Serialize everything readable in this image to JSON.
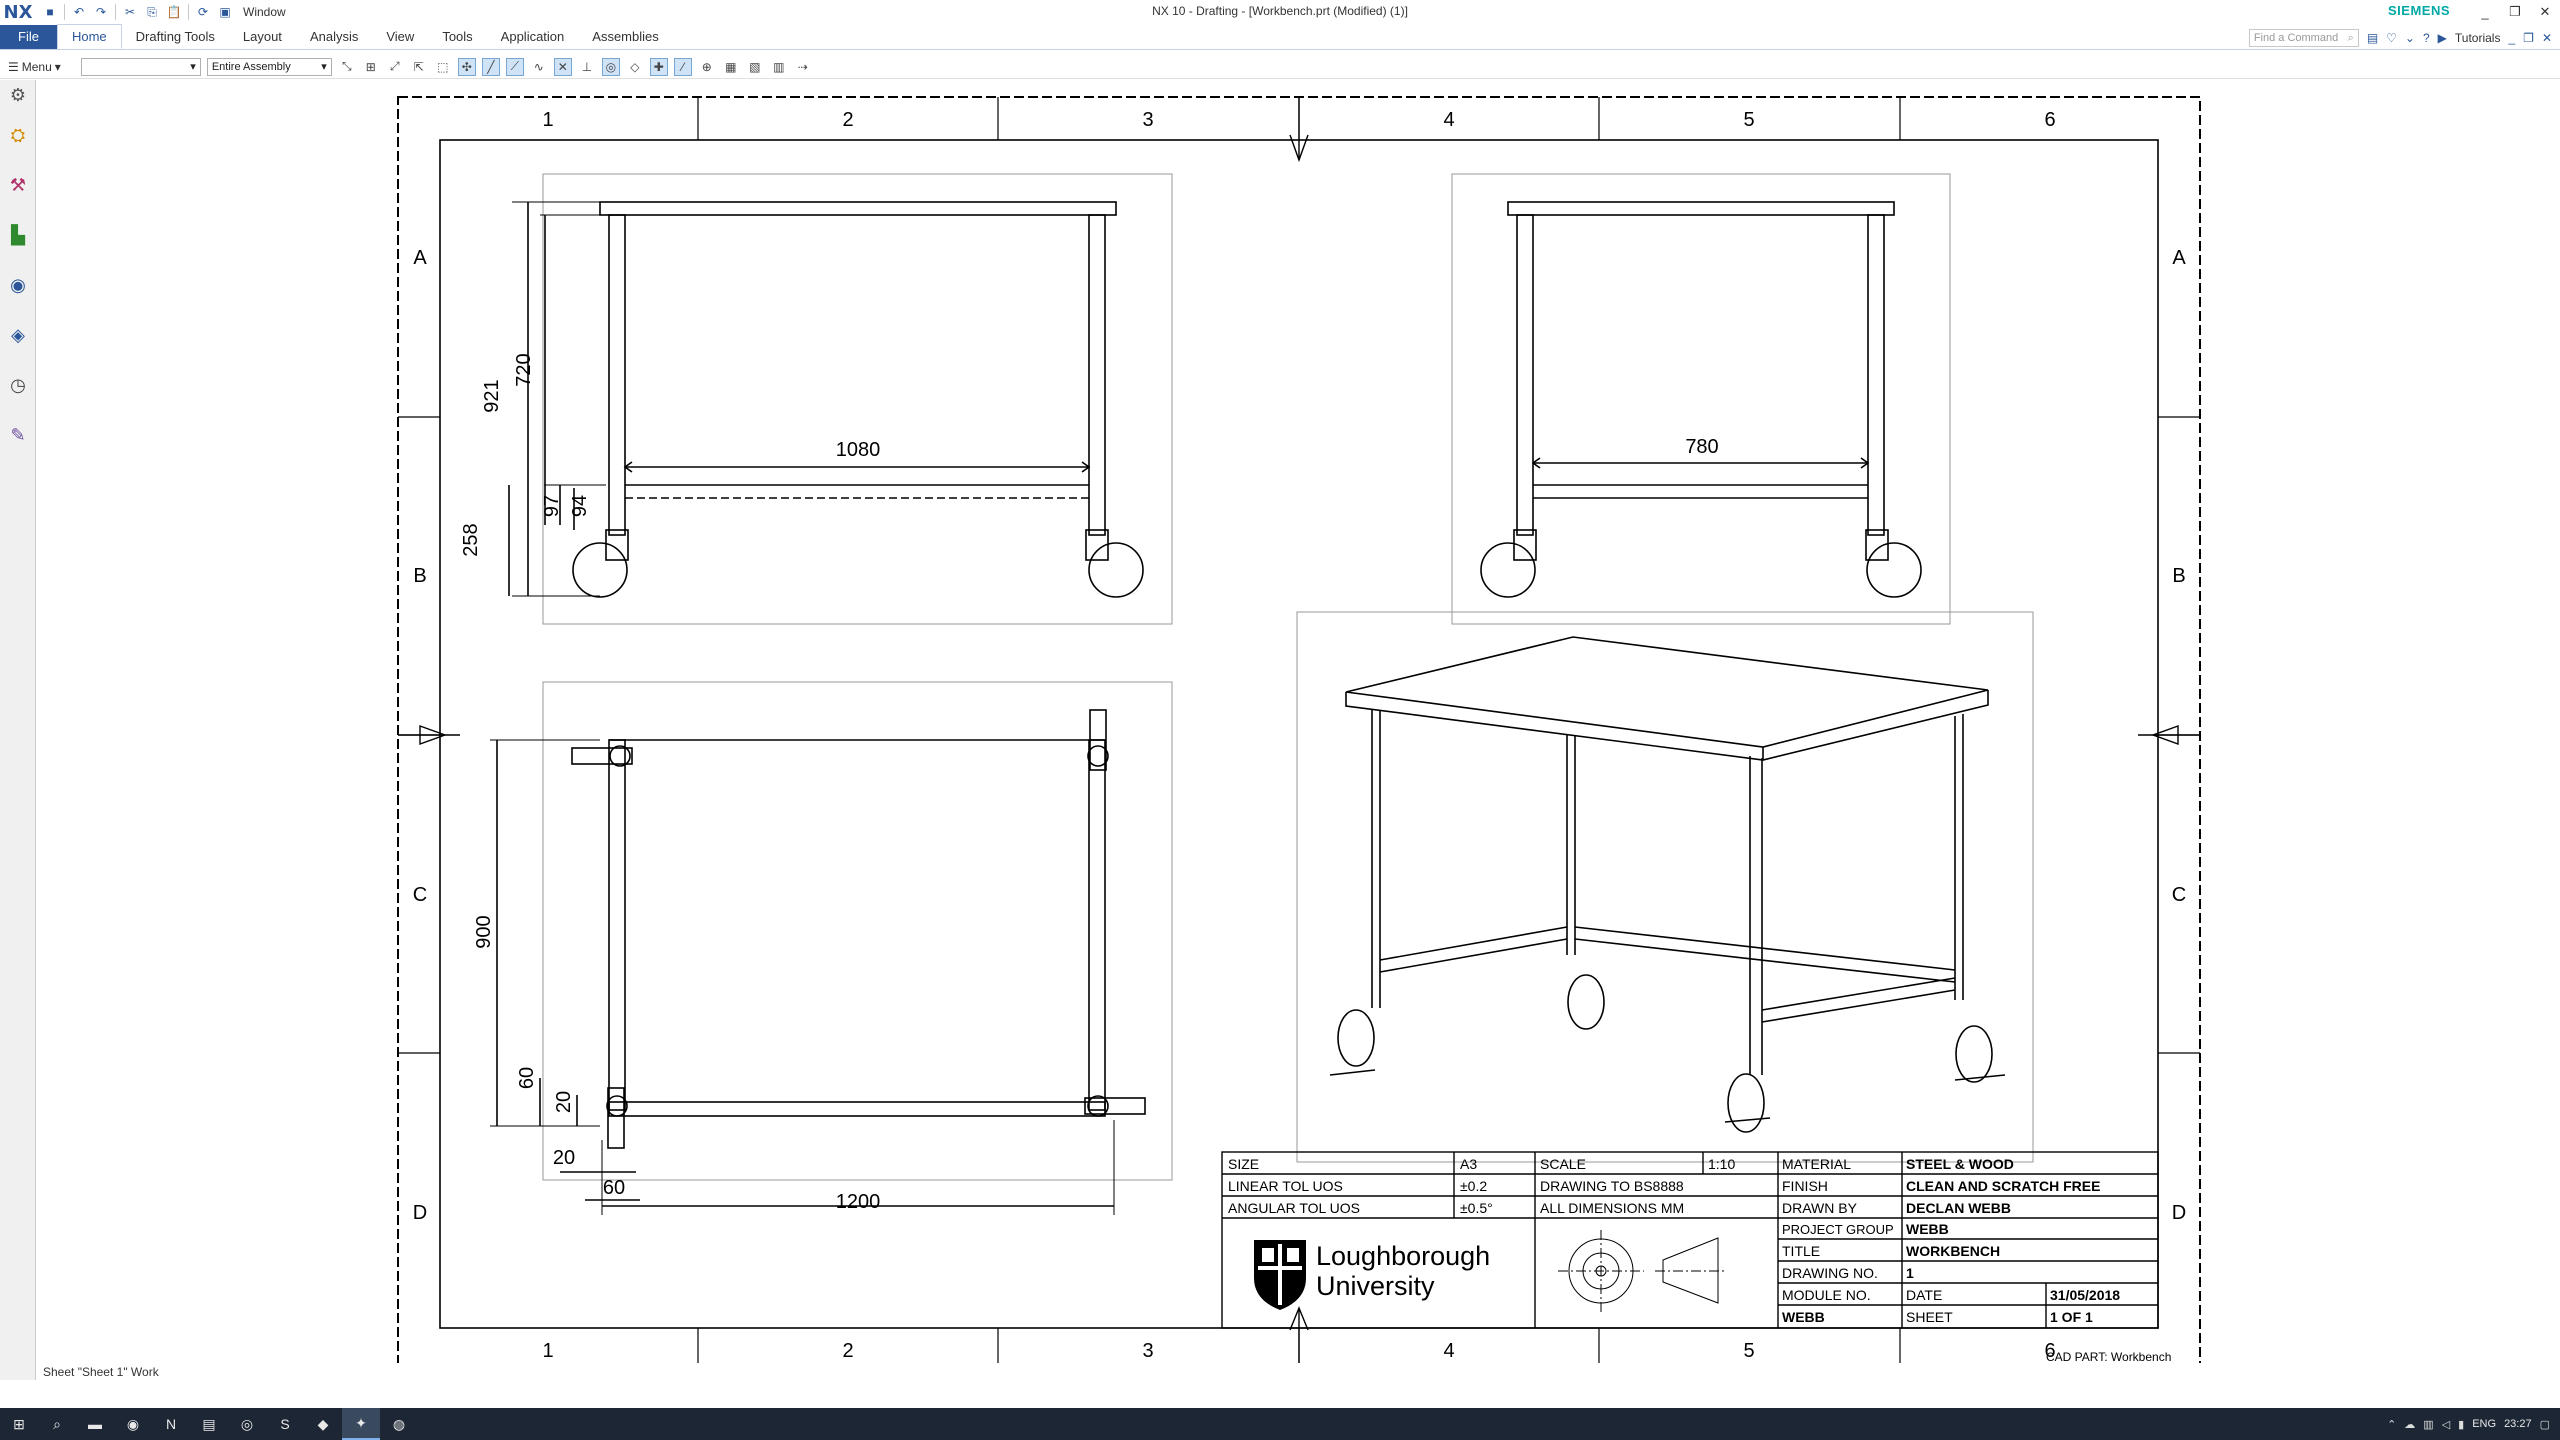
{
  "window": {
    "logo": "NX",
    "title": "NX 10 - Drafting - [Workbench.prt (Modified)   (1)]",
    "brand": "SIEMENS",
    "window_menu": "Window",
    "controls": [
      "_",
      "❐",
      "✕"
    ]
  },
  "ribbon": {
    "tabs": [
      "File",
      "Home",
      "Drafting Tools",
      "Layout",
      "Analysis",
      "View",
      "Tools",
      "Application",
      "Assemblies"
    ],
    "active_tab": "Home",
    "command_search_placeholder": "Find a Command",
    "tutorials_label": "Tutorials"
  },
  "toolbar": {
    "menu_label": "Menu",
    "filter_value": "",
    "assembly_scope": "Entire Assembly"
  },
  "drawing": {
    "zone_columns": [
      "1",
      "2",
      "3",
      "4",
      "5",
      "6"
    ],
    "zone_rows": [
      "A",
      "B",
      "C",
      "D"
    ],
    "dimensions": {
      "front_width": "1080",
      "overall_height": "921",
      "table_height": "720",
      "lower_height": "258",
      "rail_97": "97",
      "rail_94": "94",
      "side_width": "780",
      "plan_depth": "900",
      "plan_width": "1200",
      "offset_60_v": "60",
      "offset_20_v": "20",
      "offset_20_h": "20",
      "offset_60_h": "60"
    },
    "title_block": {
      "size_label": "SIZE",
      "size_value": "A3",
      "scale_label": "SCALE",
      "scale_value": "1:10",
      "material_label": "MATERIAL",
      "material_value": "STEEL & WOOD",
      "linear_tol_label": "LINEAR TOL UOS",
      "linear_tol_value": "±0.2",
      "drawing_to_label": "DRAWING TO BS8888",
      "finish_label": "FINISH",
      "finish_value": "CLEAN AND SCRATCH FREE",
      "angular_tol_label": "ANGULAR TOL UOS",
      "angular_tol_value": "±0.5°",
      "all_dims_label": "ALL DIMENSIONS MM",
      "drawn_by_label": "DRAWN BY",
      "drawn_by_value": "DECLAN WEBB",
      "project_group_label": "PROJECT GROUP",
      "project_group_value": "WEBB",
      "title_label": "TITLE",
      "title_value": "WORKBENCH",
      "drawing_no_label": "DRAWING NO.",
      "drawing_no_value": "1",
      "module_no_label": "MODULE NO.",
      "date_label": "DATE",
      "date_value": "31/05/2018",
      "module_value": "WEBB",
      "sheet_label": "SHEET",
      "sheet_value": "1 OF 1",
      "university_line1": "Loughborough",
      "university_line2": "University"
    },
    "cad_part_label": "CAD PART: Workbench"
  },
  "status": {
    "text": "Sheet \"Sheet 1\" Work"
  },
  "taskbar": {
    "language": "ENG",
    "time": "23:27"
  },
  "colors": {
    "accent": "#2b579a",
    "brand": "#00a9a6",
    "taskbar": "#1c2634"
  }
}
